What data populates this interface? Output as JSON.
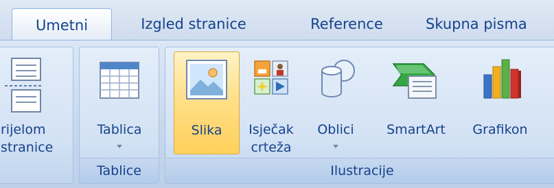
{
  "tabs": [
    {
      "label": "Umetni",
      "active": true
    },
    {
      "label": "Izgled stranice",
      "active": false
    },
    {
      "label": "Reference",
      "active": false
    },
    {
      "label": "Skupna pisma",
      "active": false
    }
  ],
  "groups": {
    "partial": {
      "button_label_1": "rijelom",
      "button_label_2": "stranice"
    },
    "tablice": {
      "label": "Tablice",
      "button_label": "Tablica"
    },
    "ilustracije": {
      "label": "Ilustracije",
      "buttons": [
        {
          "label_1": "Slika",
          "label_2": ""
        },
        {
          "label_1": "Isječak",
          "label_2": "crteža"
        },
        {
          "label_1": "Oblici",
          "label_2": ""
        },
        {
          "label_1": "SmartArt",
          "label_2": ""
        },
        {
          "label_1": "Grafikon",
          "label_2": ""
        }
      ]
    }
  },
  "colors": {
    "accent_text": "#15428b",
    "selected_fill": "#ffd05a",
    "ribbon_bg": "#c7d8ee"
  },
  "icons": [
    "page-break-icon",
    "table-icon",
    "picture-icon",
    "clipart-icon",
    "shapes-icon",
    "smartart-icon",
    "chart-icon"
  ]
}
